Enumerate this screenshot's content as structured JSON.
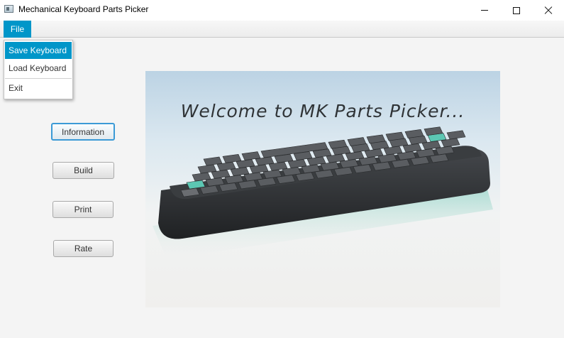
{
  "window": {
    "title": "Mechanical Keyboard Parts Picker",
    "icon": "app-window-icon",
    "controls": [
      "minimize-icon",
      "maximize-icon",
      "close-icon"
    ]
  },
  "menubar": {
    "file_label": "File"
  },
  "file_menu": {
    "items": [
      {
        "label": "Save Keyboard",
        "highlighted": true
      },
      {
        "label": "Load Keyboard",
        "highlighted": false
      },
      {
        "label": "Exit",
        "highlighted": false
      }
    ]
  },
  "sidebar": {
    "buttons": [
      {
        "label": "Information",
        "focused": true
      },
      {
        "label": "Build",
        "focused": false
      },
      {
        "label": "Print",
        "focused": false
      },
      {
        "label": "Rate",
        "focused": false
      }
    ]
  },
  "hero": {
    "caption": "Welcome to MK Parts Picker..."
  },
  "colors": {
    "accent": "#0096c9",
    "focus_ring": "#3b9ad6",
    "background": "#f4f4f4",
    "keyboard_case": "#2e3033",
    "keycap_accent": "#5cc7b3"
  }
}
